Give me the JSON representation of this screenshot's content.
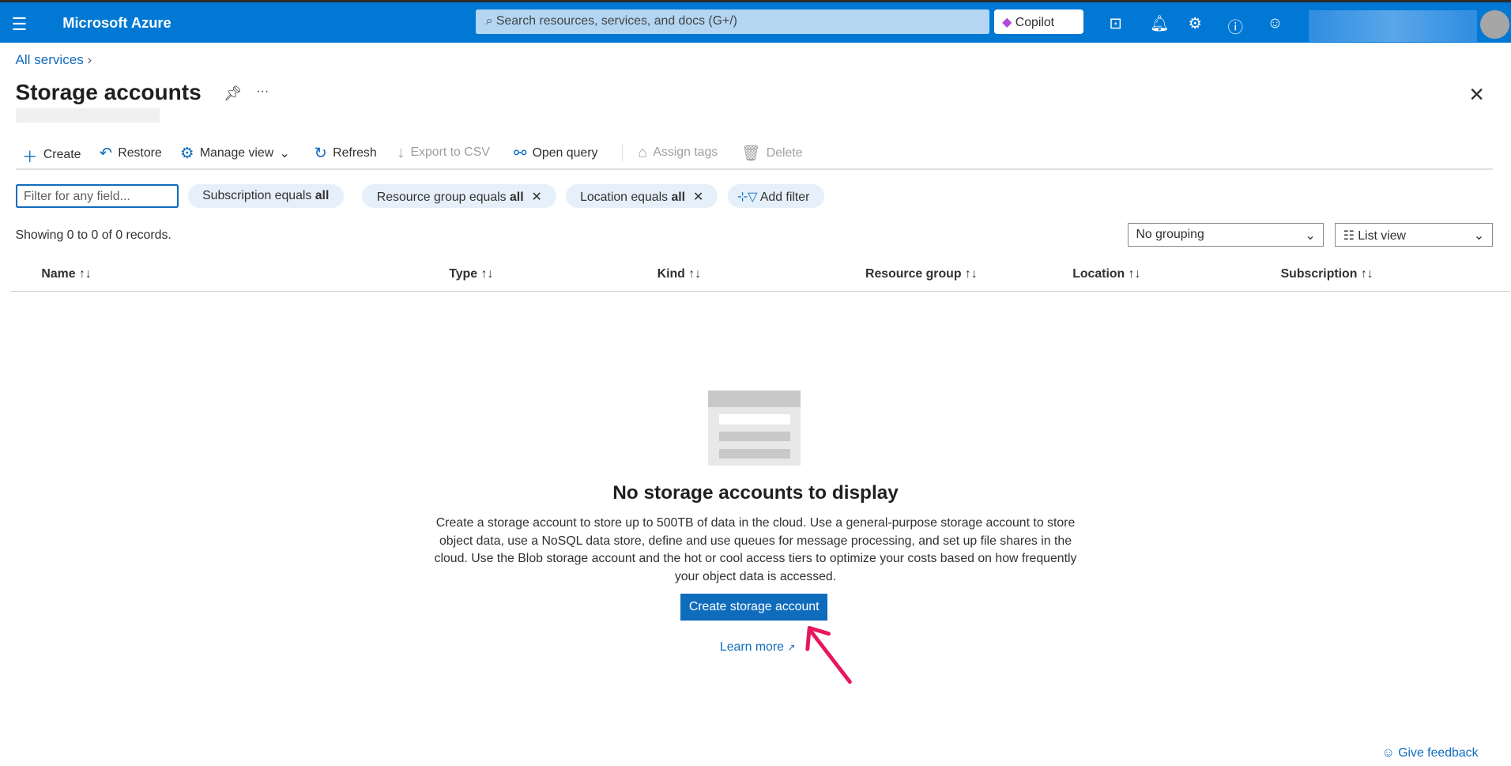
{
  "header": {
    "brand": "Microsoft Azure",
    "search_placeholder": "Search resources, services, and docs (G+/)",
    "copilot": "Copilot"
  },
  "breadcrumb": {
    "all_services": "All services"
  },
  "page": {
    "title": "Storage accounts"
  },
  "toolbar": {
    "create": "Create",
    "restore": "Restore",
    "manage_view": "Manage view",
    "refresh": "Refresh",
    "export": "Export to CSV",
    "open_query": "Open query",
    "assign_tags": "Assign tags",
    "delete": "Delete"
  },
  "filters": {
    "placeholder": "Filter for any field...",
    "subscription": "Subscription equals ",
    "resource_group": "Resource group equals ",
    "location": "Location equals ",
    "value": "all",
    "add_filter": "Add filter"
  },
  "records": "Showing 0 to 0 of 0 records.",
  "grouping": "No grouping",
  "view": "List view",
  "columns": [
    "Name",
    "Type",
    "Kind",
    "Resource group",
    "Location",
    "Subscription"
  ],
  "empty": {
    "title": "No storage accounts to display",
    "description": "Create a storage account to store up to 500TB of data in the cloud. Use a general-purpose storage account to store object data, use a NoSQL data store, define and use queues for message processing, and set up file shares in the cloud. Use the Blob storage account and the hot or cool access tiers to optimize your costs based on how frequently your object data is accessed.",
    "button": "Create storage account",
    "learn_more": "Learn more"
  },
  "feedback": "Give feedback",
  "colors": {
    "accent": "#0078d4",
    "link": "#0f6cbd",
    "arrow": "#e8175d"
  }
}
